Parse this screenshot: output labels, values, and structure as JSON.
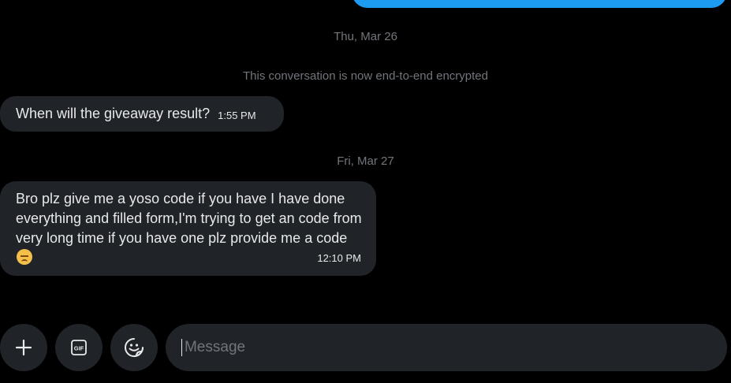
{
  "conversation": {
    "dates": {
      "first": "Thu, Mar 26",
      "second": "Fri, Mar 27"
    },
    "encryption_notice": "This conversation is now end-to-end encrypted",
    "messages": [
      {
        "text": "When will the giveaway result?",
        "time": "1:55 PM"
      },
      {
        "text": "Bro plz give me a yoso code if you have I have done everything and filled form,I'm trying to get an code from very long time if you have one plz provide me a code",
        "emoji": "disappointed-face-emoji",
        "time": "12:10 PM"
      }
    ]
  },
  "composer": {
    "placeholder": "Message",
    "value": "",
    "icons": {
      "add": "plus-icon",
      "gif": "gif-icon",
      "emoji": "emoji-icon"
    }
  },
  "colors": {
    "background": "#000000",
    "bubble_received": "#202327",
    "bubble_sent": "#1d9bf0",
    "muted_text": "#71767b",
    "text": "#e7e9ea"
  }
}
